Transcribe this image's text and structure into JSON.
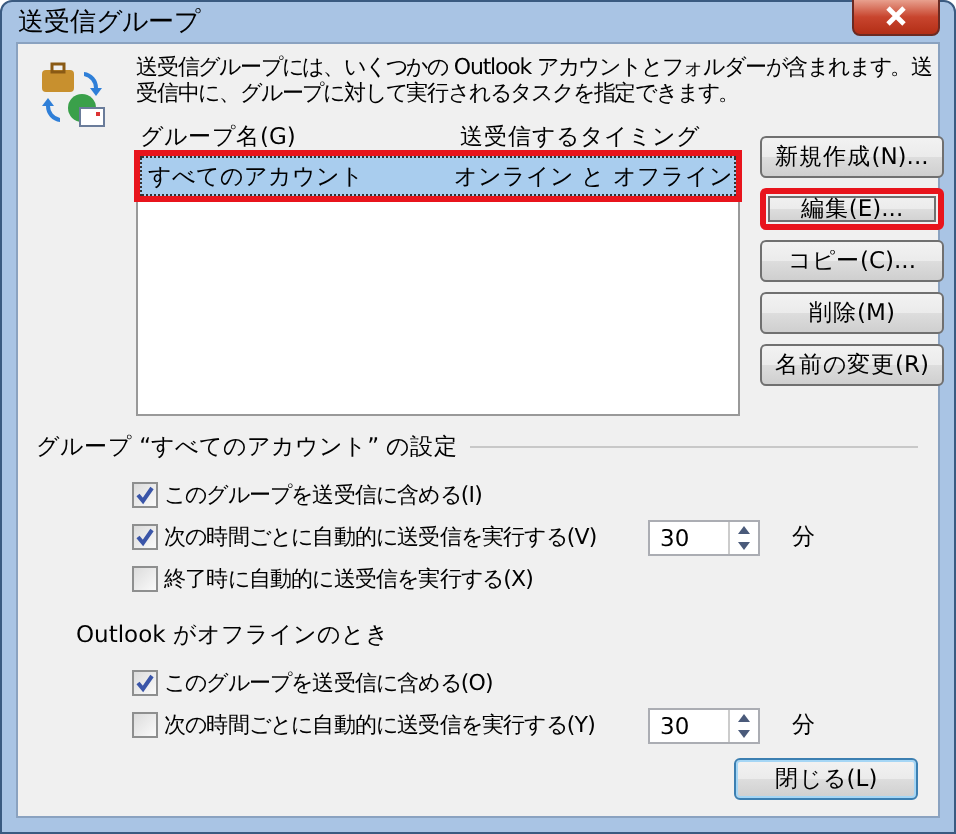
{
  "window": {
    "title": "送受信グループ"
  },
  "description": "送受信グループには、いくつかの Outlook アカウントとフォルダーが含まれます。送受信中に、グループに対して実行されるタスクを指定できます。",
  "list": {
    "columns": [
      "グループ名(G)",
      "送受信するタイミング"
    ],
    "rows": [
      {
        "name": "すべてのアカウント",
        "timing": "オンライン と オフライン",
        "selected": true,
        "highlighted": true
      }
    ]
  },
  "buttons": [
    {
      "label": "新規作成(N)...",
      "highlighted": false
    },
    {
      "label": "編集(E)...",
      "highlighted": true
    },
    {
      "label": "コピー(C)...",
      "highlighted": false
    },
    {
      "label": "削除(M)",
      "highlighted": false
    },
    {
      "label": "名前の変更(R)",
      "highlighted": false
    }
  ],
  "sections": [
    {
      "title": "グループ “すべてのアカウント” の設定",
      "kind": "framed",
      "options": [
        {
          "kind": "checkbox",
          "label": "このグループを送受信に含める(I)",
          "checked": true
        },
        {
          "kind": "interval",
          "label": "次の時間ごとに自動的に送受信を実行する(V)",
          "checked": true,
          "value": "30",
          "unit": "分"
        },
        {
          "kind": "checkbox",
          "label": "終了時に自動的に送受信を実行する(X)",
          "checked": false
        }
      ]
    },
    {
      "title": "Outlook がオフラインのとき",
      "kind": "plain",
      "options": [
        {
          "kind": "checkbox",
          "label": "このグループを送受信に含める(O)",
          "checked": true
        },
        {
          "kind": "interval",
          "label": "次の時間ごとに自動的に送受信を実行する(Y)",
          "checked": false,
          "value": "30",
          "unit": "分"
        }
      ]
    }
  ],
  "close_button": "閉じる(L)"
}
